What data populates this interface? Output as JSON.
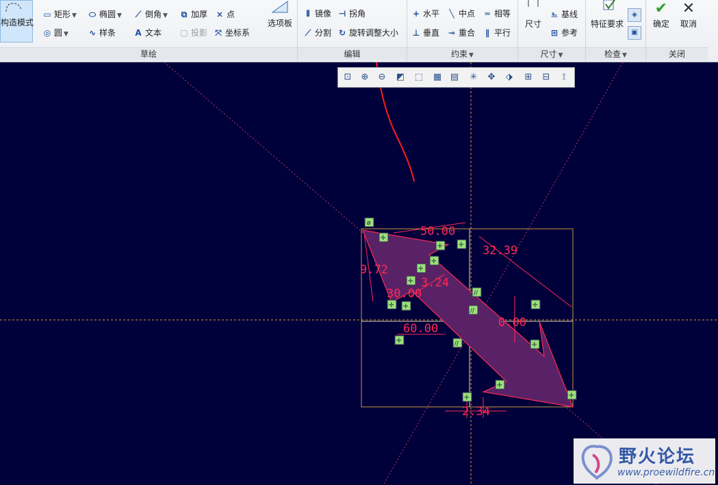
{
  "ribbon": {
    "sketch_group": {
      "construct_mode": "构造模式",
      "tools": {
        "rectangle": "矩形",
        "ellipse": "椭圆",
        "chamfer": "倒角",
        "thicken": "加厚",
        "point": "点",
        "circle": "圆",
        "spline": "样条",
        "text": "文本",
        "project": "投影",
        "coordsys": "坐标系"
      },
      "palette": "选项板",
      "label": "草绘"
    },
    "edit_group": {
      "mirror": "镜像",
      "corner": "拐角",
      "divide": "分割",
      "rotate_resize": "旋转调整大小",
      "label": "编辑"
    },
    "constraint_group": {
      "horizontal": "水平",
      "midpoint": "中点",
      "equal": "相等",
      "vertical": "垂直",
      "coincident": "重合",
      "parallel": "平行",
      "label": "约束"
    },
    "dimension_group": {
      "dimension": "尺寸",
      "baseline": "基线",
      "reference": "参考",
      "label": "尺寸"
    },
    "inspect_group": {
      "feature_requirements": "特征要求",
      "label": "检查"
    },
    "close_group": {
      "ok": "确定",
      "cancel": "取消",
      "label": "关闭"
    }
  },
  "sketch": {
    "dims": [
      "50.00",
      "32.39",
      "9.72",
      "3.24",
      "30.00",
      "60.00",
      "0.00",
      "2.34"
    ]
  },
  "watermark": {
    "title": "野火论坛",
    "url": "www.proewildfire.cn"
  },
  "colors": {
    "canvas": "#00003a",
    "sketch_line": "#ff2a55",
    "arrow_fill": "#5a2266",
    "frame": "#c99a3a",
    "centerline": "#e0a030",
    "constraint_badge": "#9be07a",
    "annotation": "#ff1a1a"
  }
}
